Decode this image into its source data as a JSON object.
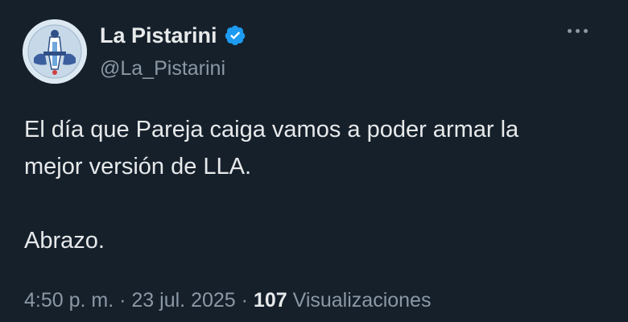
{
  "author": {
    "display_name": "La Pistarini",
    "handle": "@La_Pistarini",
    "verified": true,
    "avatar_icon": "avatar-emblem-icon"
  },
  "tweet": {
    "text_line_1": "El día que Pareja caiga vamos a poder armar la",
    "text_line_2": "mejor versión de LLA.",
    "text_line_3": "Abrazo.",
    "time": "4:50 p. m.",
    "separator": "·",
    "date": "23 jul. 2025",
    "views_count": "107",
    "views_label": "Visualizaciones"
  },
  "colors": {
    "background": "#15202b",
    "text_primary": "#e7e9ea",
    "text_secondary": "#8b98a5",
    "verified_badge": "#1d9bf0"
  },
  "icons": {
    "verified": "verified-badge-icon",
    "more": "more-options-icon"
  }
}
